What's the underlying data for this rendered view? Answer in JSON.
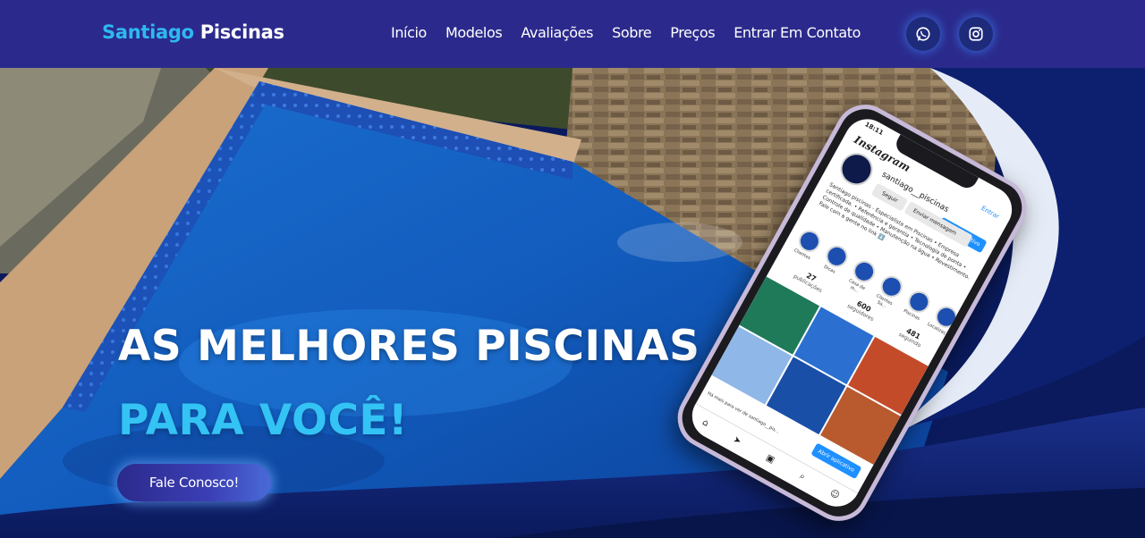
{
  "brand": {
    "part1": "Santiago",
    "part2": "Piscinas"
  },
  "nav": {
    "items": [
      {
        "label": "Início"
      },
      {
        "label": "Modelos"
      },
      {
        "label": "Avaliações"
      },
      {
        "label": "Sobre"
      },
      {
        "label": "Preços"
      },
      {
        "label": "Entrar Em Contato"
      }
    ],
    "social": [
      {
        "icon": "whatsapp-icon"
      },
      {
        "icon": "instagram-icon"
      }
    ]
  },
  "hero": {
    "headline_line1": "AS MELHORES PISCINAS",
    "headline_line2": "PARA VOCÊ!",
    "cta_label": "Fale Conosco!"
  },
  "phone": {
    "time": "18:11",
    "app_name": "Instagram",
    "enter_label": "Entrar",
    "username": "santiago__piscinas",
    "open_app_label": "Abrir aplicativo",
    "follow_label": "Seguir",
    "message_label": "Enviar mensagem",
    "bio": "Santiago piscinas - Especialista em Piscinas • Empresa certificada. • Referência e garantia • Tecnologia de ponta • Controle de qualidade • Manutenção na água • Revestimento. Fale com a gente no link ⬇️",
    "highlights": [
      "Clientes",
      "Dicas",
      "Casa de m...",
      "Clientes Sa...",
      "Piscinas",
      "Localização"
    ],
    "stats": [
      {
        "value": "27",
        "label": "publicações"
      },
      {
        "value": "600",
        "label": "seguidores"
      },
      {
        "value": "481",
        "label": "seguindo"
      }
    ],
    "banner_text": "Há mais para ver de santiago__pis...",
    "bottom_open_app": "Abrir aplicativo"
  },
  "colors": {
    "navbar": "#2b2a8c",
    "brand_accent": "#2fb8f0",
    "headline_accent": "#33c3f4",
    "hero_dark": "#0a1a5c"
  }
}
